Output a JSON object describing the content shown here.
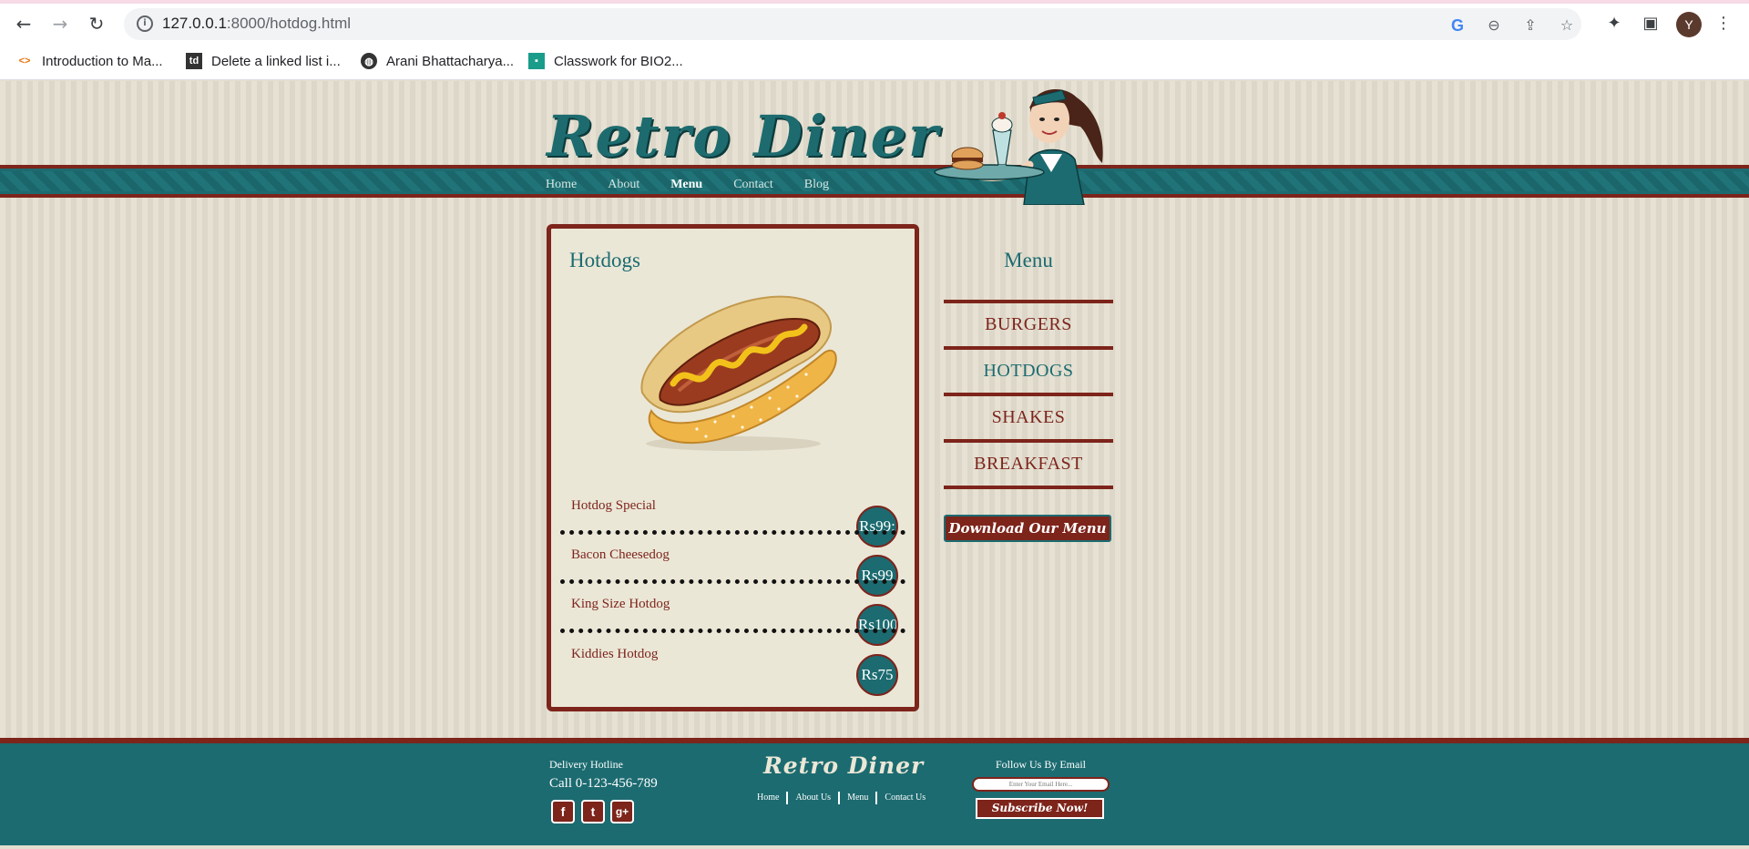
{
  "browser": {
    "url_host": "127.0.0.1",
    "url_rest": ":8000/hotdog.html",
    "bookmarks": [
      {
        "label": "Introduction to Ma...",
        "icon": "google-colab-icon"
      },
      {
        "label": "Delete a linked list i...",
        "icon": "td-icon"
      },
      {
        "label": "Arani Bhattacharya...",
        "icon": "globe-icon"
      },
      {
        "label": "Classwork for BIO2...",
        "icon": "classroom-icon"
      }
    ],
    "avatar_letter": "Y"
  },
  "header": {
    "logo_text": "Retro Diner",
    "nav": [
      {
        "label": "Home"
      },
      {
        "label": "About"
      },
      {
        "label": "Menu"
      },
      {
        "label": "Contact"
      },
      {
        "label": "Blog"
      }
    ]
  },
  "panel": {
    "title": "Hotdogs",
    "items": [
      {
        "name": "Hotdog Special",
        "price": "Rs99;"
      },
      {
        "name": "Bacon Cheesedog",
        "price": "Rs99"
      },
      {
        "name": "King Size Hotdog",
        "price": "Rs100"
      },
      {
        "name": "Kiddies Hotdog",
        "price": "Rs75"
      }
    ]
  },
  "sidebar": {
    "title": "Menu",
    "items": [
      {
        "label": "BURGERS"
      },
      {
        "label": "HOTDOGS"
      },
      {
        "label": "SHAKES"
      },
      {
        "label": "BREAKFAST"
      }
    ],
    "download_label": "Download Our Menu"
  },
  "footer": {
    "hotline_label": "Delivery Hotline",
    "hotline": "Call 0-123-456-789",
    "social": [
      "f",
      "t",
      "g+"
    ],
    "logo_text": "Retro Diner",
    "links": [
      "Home",
      "About Us",
      "Menu",
      "Contact Us"
    ],
    "follow_label": "Follow Us By Email",
    "email_placeholder": "Enter Your Email Here...",
    "subscribe_label": "Subscribe Now!"
  },
  "colors": {
    "teal": "#1c6b70",
    "maroon": "#7d241b",
    "cream": "#ebe7d7"
  }
}
